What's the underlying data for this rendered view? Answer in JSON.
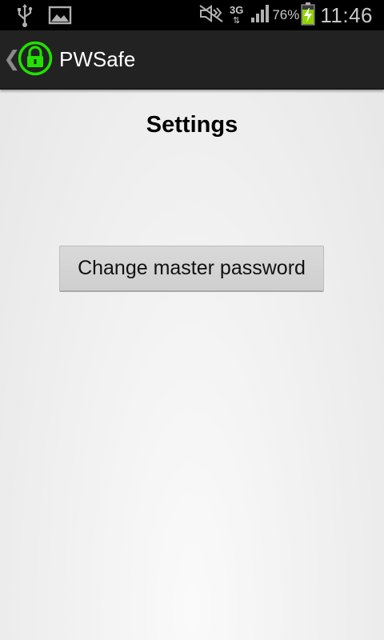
{
  "status_bar": {
    "icons": [
      "usb-icon",
      "image-icon",
      "mute-icon",
      "signal-icon",
      "battery-charging-icon"
    ],
    "network": "3G",
    "battery_percent": "76%",
    "time": "11:46"
  },
  "action_bar": {
    "title": "PWSafe",
    "app_icon": "lock-icon",
    "accent": "#22e000"
  },
  "main": {
    "title": "Settings",
    "change_password_label": "Change master password"
  }
}
